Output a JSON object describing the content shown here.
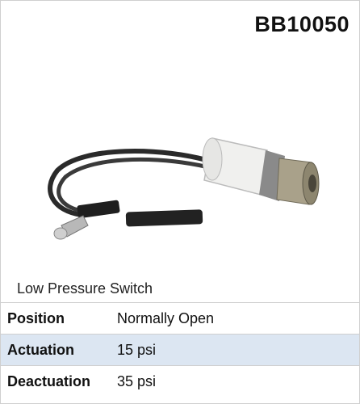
{
  "header": {
    "part_number": "BB10050"
  },
  "product": {
    "caption": "Low Pressure Switch"
  },
  "specs": [
    {
      "label": "Position",
      "value": "Normally Open"
    },
    {
      "label": "Actuation",
      "value": "15 psi"
    },
    {
      "label": "Deactuation",
      "value": "35 psi"
    }
  ]
}
